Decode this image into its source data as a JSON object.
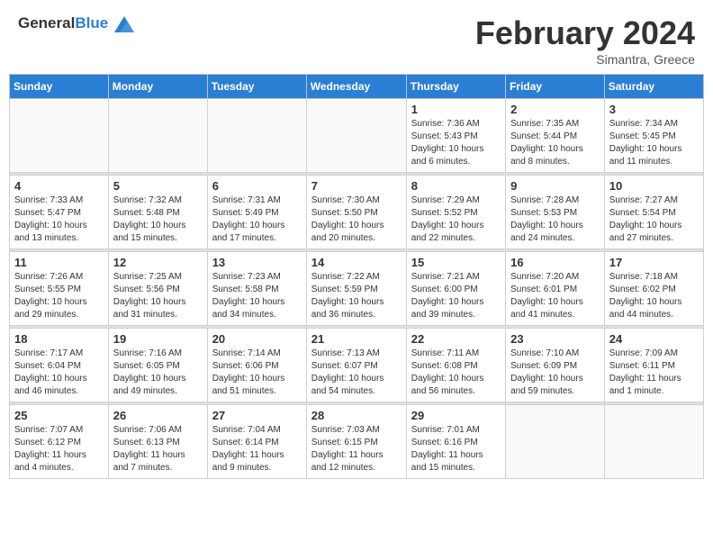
{
  "header": {
    "logo_general": "General",
    "logo_blue": "Blue",
    "title": "February 2024",
    "subtitle": "Simantra, Greece"
  },
  "days_of_week": [
    "Sunday",
    "Monday",
    "Tuesday",
    "Wednesday",
    "Thursday",
    "Friday",
    "Saturday"
  ],
  "weeks": [
    [
      {
        "day": "",
        "info": ""
      },
      {
        "day": "",
        "info": ""
      },
      {
        "day": "",
        "info": ""
      },
      {
        "day": "",
        "info": ""
      },
      {
        "day": "1",
        "info": "Sunrise: 7:36 AM\nSunset: 5:43 PM\nDaylight: 10 hours\nand 6 minutes."
      },
      {
        "day": "2",
        "info": "Sunrise: 7:35 AM\nSunset: 5:44 PM\nDaylight: 10 hours\nand 8 minutes."
      },
      {
        "day": "3",
        "info": "Sunrise: 7:34 AM\nSunset: 5:45 PM\nDaylight: 10 hours\nand 11 minutes."
      }
    ],
    [
      {
        "day": "4",
        "info": "Sunrise: 7:33 AM\nSunset: 5:47 PM\nDaylight: 10 hours\nand 13 minutes."
      },
      {
        "day": "5",
        "info": "Sunrise: 7:32 AM\nSunset: 5:48 PM\nDaylight: 10 hours\nand 15 minutes."
      },
      {
        "day": "6",
        "info": "Sunrise: 7:31 AM\nSunset: 5:49 PM\nDaylight: 10 hours\nand 17 minutes."
      },
      {
        "day": "7",
        "info": "Sunrise: 7:30 AM\nSunset: 5:50 PM\nDaylight: 10 hours\nand 20 minutes."
      },
      {
        "day": "8",
        "info": "Sunrise: 7:29 AM\nSunset: 5:52 PM\nDaylight: 10 hours\nand 22 minutes."
      },
      {
        "day": "9",
        "info": "Sunrise: 7:28 AM\nSunset: 5:53 PM\nDaylight: 10 hours\nand 24 minutes."
      },
      {
        "day": "10",
        "info": "Sunrise: 7:27 AM\nSunset: 5:54 PM\nDaylight: 10 hours\nand 27 minutes."
      }
    ],
    [
      {
        "day": "11",
        "info": "Sunrise: 7:26 AM\nSunset: 5:55 PM\nDaylight: 10 hours\nand 29 minutes."
      },
      {
        "day": "12",
        "info": "Sunrise: 7:25 AM\nSunset: 5:56 PM\nDaylight: 10 hours\nand 31 minutes."
      },
      {
        "day": "13",
        "info": "Sunrise: 7:23 AM\nSunset: 5:58 PM\nDaylight: 10 hours\nand 34 minutes."
      },
      {
        "day": "14",
        "info": "Sunrise: 7:22 AM\nSunset: 5:59 PM\nDaylight: 10 hours\nand 36 minutes."
      },
      {
        "day": "15",
        "info": "Sunrise: 7:21 AM\nSunset: 6:00 PM\nDaylight: 10 hours\nand 39 minutes."
      },
      {
        "day": "16",
        "info": "Sunrise: 7:20 AM\nSunset: 6:01 PM\nDaylight: 10 hours\nand 41 minutes."
      },
      {
        "day": "17",
        "info": "Sunrise: 7:18 AM\nSunset: 6:02 PM\nDaylight: 10 hours\nand 44 minutes."
      }
    ],
    [
      {
        "day": "18",
        "info": "Sunrise: 7:17 AM\nSunset: 6:04 PM\nDaylight: 10 hours\nand 46 minutes."
      },
      {
        "day": "19",
        "info": "Sunrise: 7:16 AM\nSunset: 6:05 PM\nDaylight: 10 hours\nand 49 minutes."
      },
      {
        "day": "20",
        "info": "Sunrise: 7:14 AM\nSunset: 6:06 PM\nDaylight: 10 hours\nand 51 minutes."
      },
      {
        "day": "21",
        "info": "Sunrise: 7:13 AM\nSunset: 6:07 PM\nDaylight: 10 hours\nand 54 minutes."
      },
      {
        "day": "22",
        "info": "Sunrise: 7:11 AM\nSunset: 6:08 PM\nDaylight: 10 hours\nand 56 minutes."
      },
      {
        "day": "23",
        "info": "Sunrise: 7:10 AM\nSunset: 6:09 PM\nDaylight: 10 hours\nand 59 minutes."
      },
      {
        "day": "24",
        "info": "Sunrise: 7:09 AM\nSunset: 6:11 PM\nDaylight: 11 hours\nand 1 minute."
      }
    ],
    [
      {
        "day": "25",
        "info": "Sunrise: 7:07 AM\nSunset: 6:12 PM\nDaylight: 11 hours\nand 4 minutes."
      },
      {
        "day": "26",
        "info": "Sunrise: 7:06 AM\nSunset: 6:13 PM\nDaylight: 11 hours\nand 7 minutes."
      },
      {
        "day": "27",
        "info": "Sunrise: 7:04 AM\nSunset: 6:14 PM\nDaylight: 11 hours\nand 9 minutes."
      },
      {
        "day": "28",
        "info": "Sunrise: 7:03 AM\nSunset: 6:15 PM\nDaylight: 11 hours\nand 12 minutes."
      },
      {
        "day": "29",
        "info": "Sunrise: 7:01 AM\nSunset: 6:16 PM\nDaylight: 11 hours\nand 15 minutes."
      },
      {
        "day": "",
        "info": ""
      },
      {
        "day": "",
        "info": ""
      }
    ]
  ]
}
